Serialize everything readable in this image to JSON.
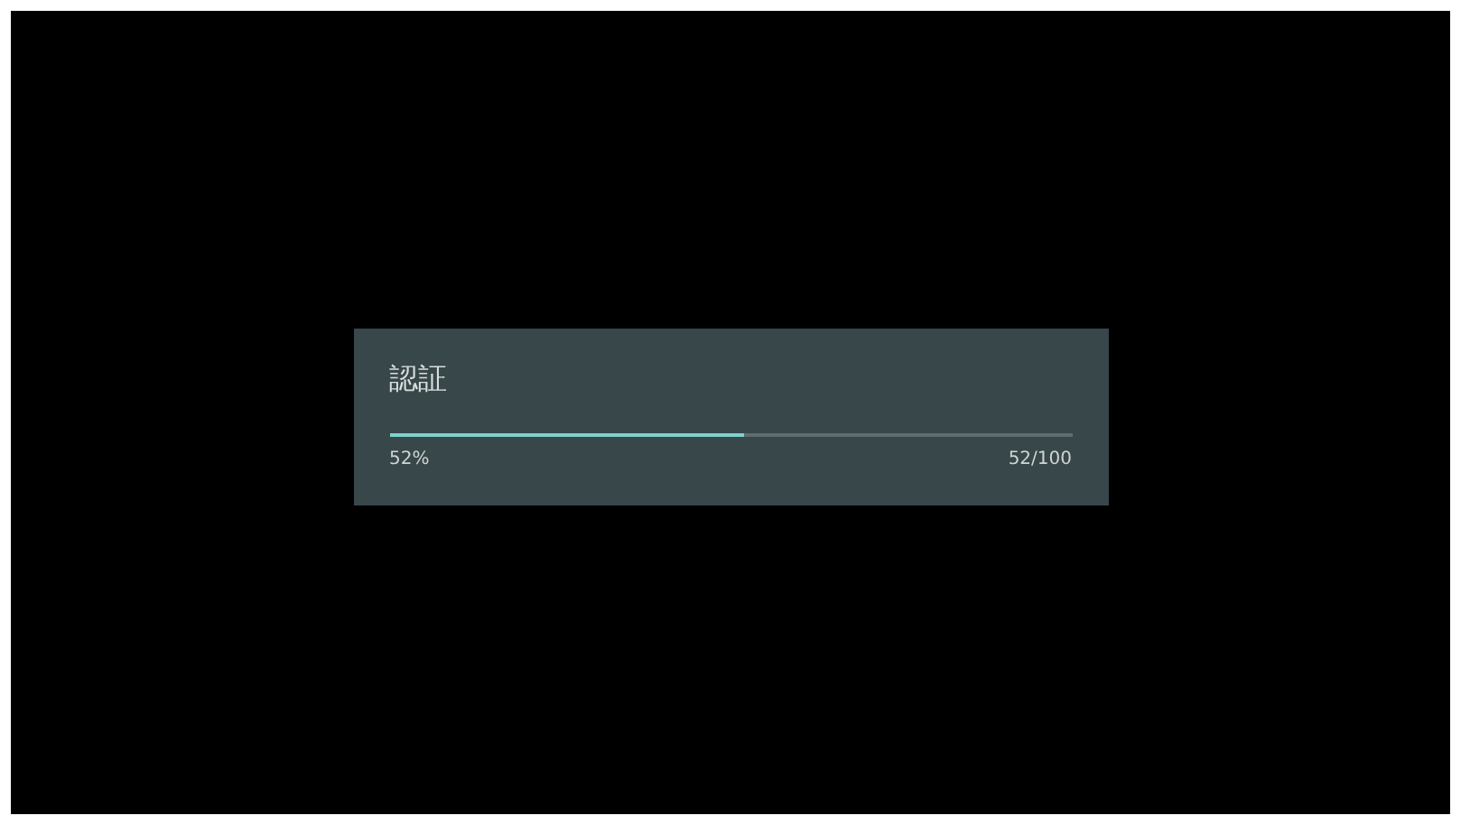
{
  "dialog": {
    "title": "認証",
    "progress": {
      "level": 0.52,
      "percent": "52%",
      "count": "52/100"
    }
  }
}
